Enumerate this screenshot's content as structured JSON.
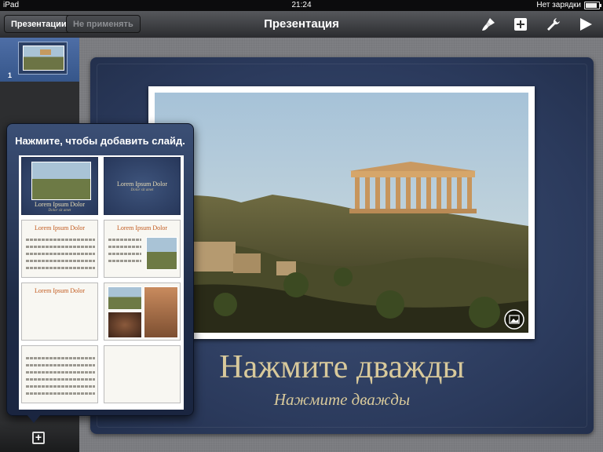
{
  "status_bar": {
    "device": "iPad",
    "time": "21:24",
    "battery_text": "Нет зарядки"
  },
  "toolbar": {
    "presentations_button": "Презентации",
    "undo_button": "Не применять",
    "title": "Презентация",
    "icons": [
      "paintbrush-icon",
      "add-media-icon",
      "wrench-icon",
      "play-icon"
    ]
  },
  "sidebar": {
    "slides": [
      {
        "number": "1"
      }
    ]
  },
  "slide": {
    "title": "Нажмите дважды",
    "subtitle": "Нажмите дважды"
  },
  "popover": {
    "title": "Нажмите, чтобы добавить слайд.",
    "layouts": [
      {
        "title": "Lorem Ipsum Dolor",
        "subtitle": "Dolor sit amet"
      },
      {
        "title": "Lorem Ipsum Dolor",
        "subtitle": "Dolor sit amet"
      },
      {
        "title": "Lorem Ipsum Dolor"
      },
      {
        "title": "Lorem Ipsum Dolor"
      },
      {
        "title": "Lorem Ipsum Dolor"
      },
      {
        "title": ""
      },
      {
        "title": ""
      },
      {
        "title": ""
      }
    ]
  },
  "colors": {
    "accent": "#4e6ea6",
    "slide_text": "#d8c99b",
    "layout_title_orange": "#c25a1e"
  }
}
